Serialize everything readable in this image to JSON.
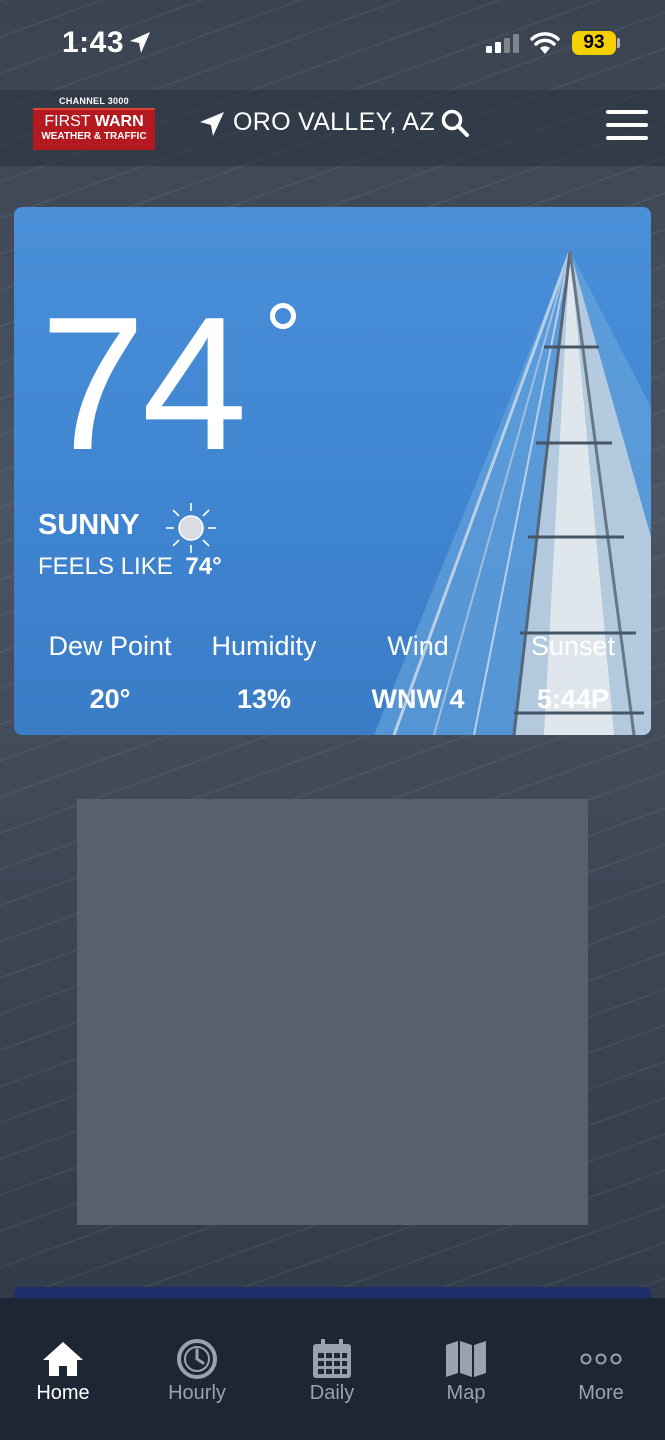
{
  "status_bar": {
    "time": "1:43",
    "battery": "93"
  },
  "header": {
    "logo": {
      "channel": "CHANNEL 3000",
      "line1a": "FIRST ",
      "line1b": "WARN",
      "line2": "WEATHER & TRAFFIC"
    },
    "location": "ORO VALLEY, AZ"
  },
  "current": {
    "temperature": "74",
    "condition": "SUNNY",
    "feels_like_label": "FEELS LIKE",
    "feels_like_value": "74°",
    "stats": [
      {
        "label": "Dew Point",
        "value": "20°"
      },
      {
        "label": "Humidity",
        "value": "13%"
      },
      {
        "label": "Wind",
        "value": "WNW 4"
      },
      {
        "label": "Sunset",
        "value": "5:44P"
      }
    ]
  },
  "tabs": [
    {
      "label": "Home",
      "icon": "home-icon",
      "active": true
    },
    {
      "label": "Hourly",
      "icon": "clock-icon",
      "active": false
    },
    {
      "label": "Daily",
      "icon": "calendar-icon",
      "active": false
    },
    {
      "label": "Map",
      "icon": "map-icon",
      "active": false
    },
    {
      "label": "More",
      "icon": "more-dots-icon",
      "active": false
    }
  ]
}
